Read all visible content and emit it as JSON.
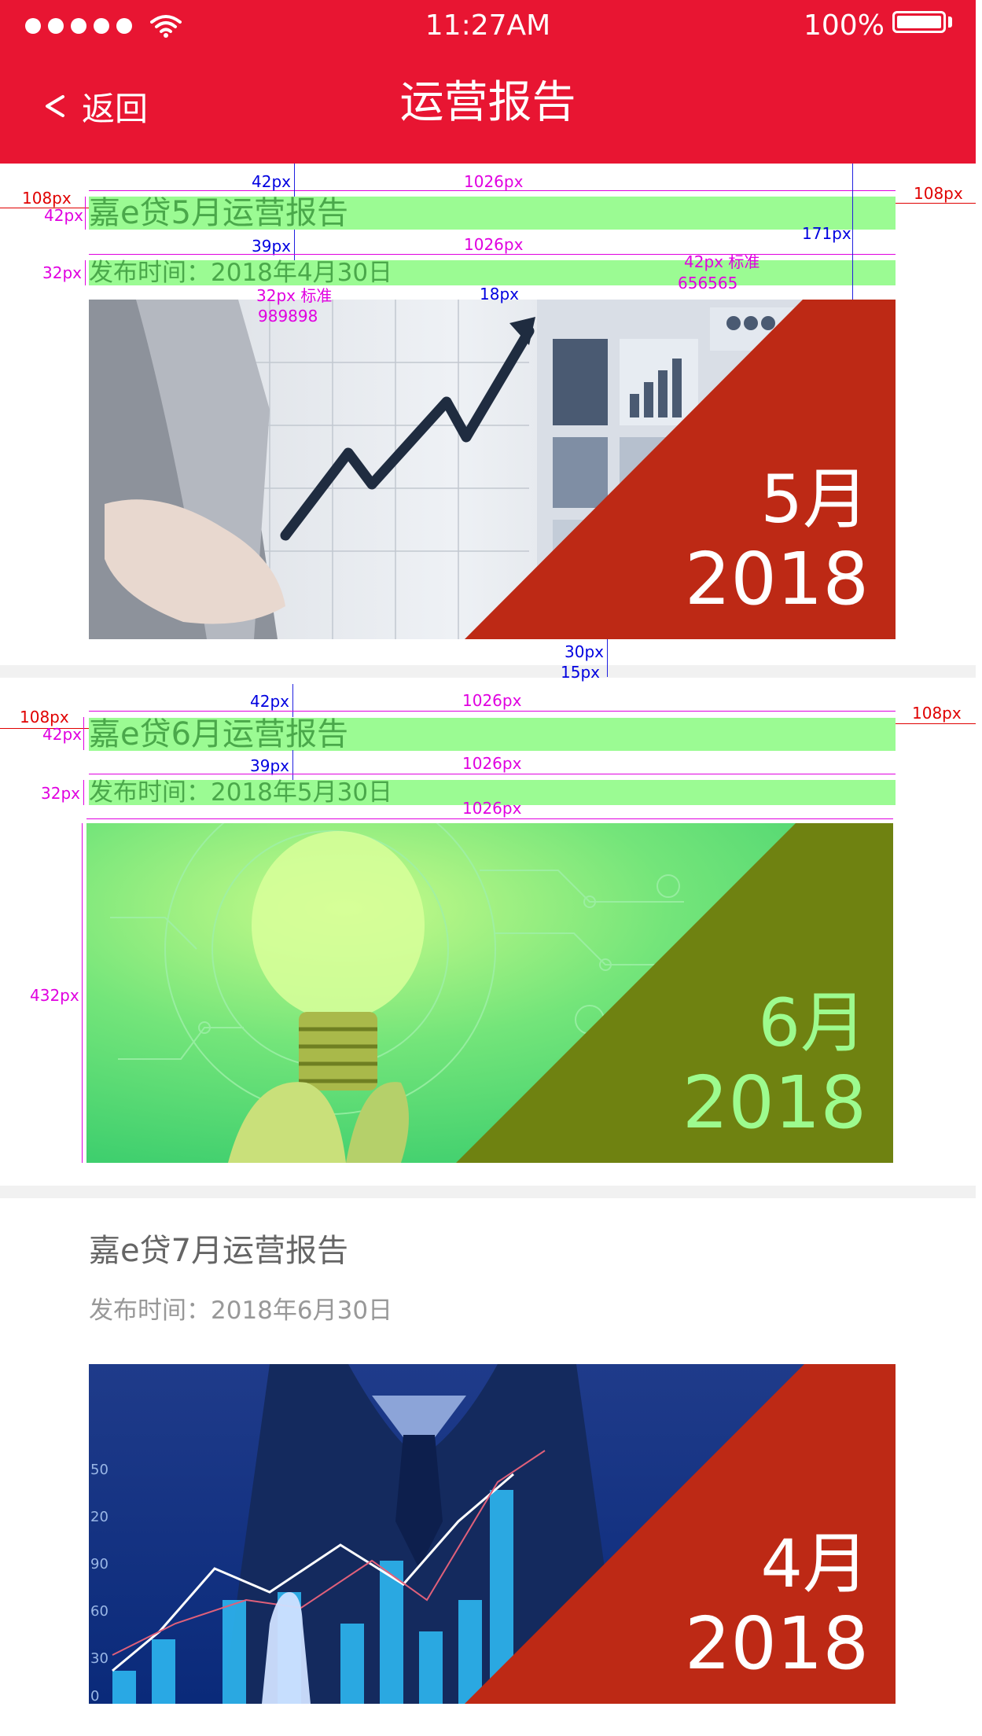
{
  "status_bar": {
    "time": "11:27AM",
    "battery_percent": "100%",
    "signal_dots": 5,
    "battery_level": 1.0
  },
  "nav": {
    "back_label": "返回",
    "title": "运营报告"
  },
  "reports": [
    {
      "title": "嘉e贷5月运营报告",
      "date": "发布时间：2018年4月30日",
      "badge_month": "5月",
      "badge_year": "2018"
    },
    {
      "title": "嘉e贷6月运营报告",
      "date": "发布时间：2018年5月30日",
      "badge_month": "6月",
      "badge_year": "2018"
    },
    {
      "title": "嘉e贷7月运营报告",
      "date": "发布时间：2018年6月30日",
      "badge_month": "4月",
      "badge_year": "2018"
    }
  ],
  "annotations": {
    "w42": "42px",
    "w1026": "1026px",
    "m108": "108px",
    "h42": "42px",
    "w39": "39px",
    "h32": "32px",
    "gap171": "171px",
    "gap18": "18px",
    "title_spec": "42px  标准",
    "title_color": "656565",
    "date_spec": "32px  标准",
    "date_color": "989898",
    "gap30": "30px",
    "gap15": "15px",
    "h432": "432px"
  },
  "colors": {
    "header_red": "#e81532",
    "badge_red": "#bd2915",
    "badge_olive": "#6f8211",
    "highlight_green": "#9bfb93",
    "title_gray": "#656565",
    "date_gray": "#989898",
    "separator": "#f1f1f1"
  }
}
